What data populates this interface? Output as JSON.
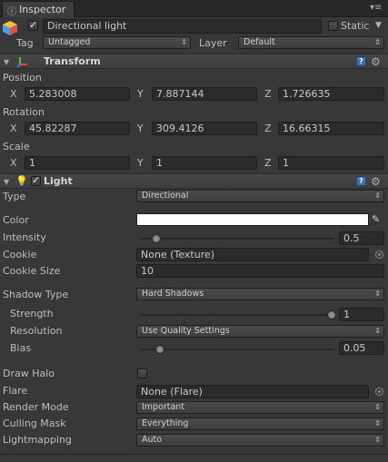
{
  "tab": {
    "label": "Inspector"
  },
  "object": {
    "name": "Directional light",
    "active": true,
    "static_label": "Static",
    "tag_label": "Tag",
    "tag_value": "Untagged",
    "layer_label": "Layer",
    "layer_value": "Default"
  },
  "transform": {
    "title": "Transform",
    "position_label": "Position",
    "rotation_label": "Rotation",
    "scale_label": "Scale",
    "x": "X",
    "y": "Y",
    "z": "Z",
    "position": {
      "x": "5.283008",
      "y": "7.887144",
      "z": "1.726635"
    },
    "rotation": {
      "x": "45.82287",
      "y": "309.4126",
      "z": "16.66315"
    },
    "scale": {
      "x": "1",
      "y": "1",
      "z": "1"
    }
  },
  "light": {
    "title": "Light",
    "enabled": true,
    "type_label": "Type",
    "type_value": "Directional",
    "color_label": "Color",
    "color_value": "#ffffff",
    "intensity_label": "Intensity",
    "intensity_value": "0.5",
    "intensity_fraction": 0.0625,
    "cookie_label": "Cookie",
    "cookie_value": "None (Texture)",
    "cookie_size_label": "Cookie Size",
    "cookie_size_value": "10",
    "shadow_type_label": "Shadow Type",
    "shadow_type_value": "Hard Shadows",
    "strength_label": "Strength",
    "strength_value": "1",
    "resolution_label": "Resolution",
    "resolution_value": "Use Quality Settings",
    "bias_label": "Bias",
    "bias_value": "0.05",
    "bias_fraction": 0.025,
    "draw_halo_label": "Draw Halo",
    "draw_halo": false,
    "flare_label": "Flare",
    "flare_value": "None (Flare)",
    "render_mode_label": "Render Mode",
    "render_mode_value": "Important",
    "culling_mask_label": "Culling Mask",
    "culling_mask_value": "Everything",
    "lightmapping_label": "Lightmapping",
    "lightmapping_value": "Auto"
  }
}
